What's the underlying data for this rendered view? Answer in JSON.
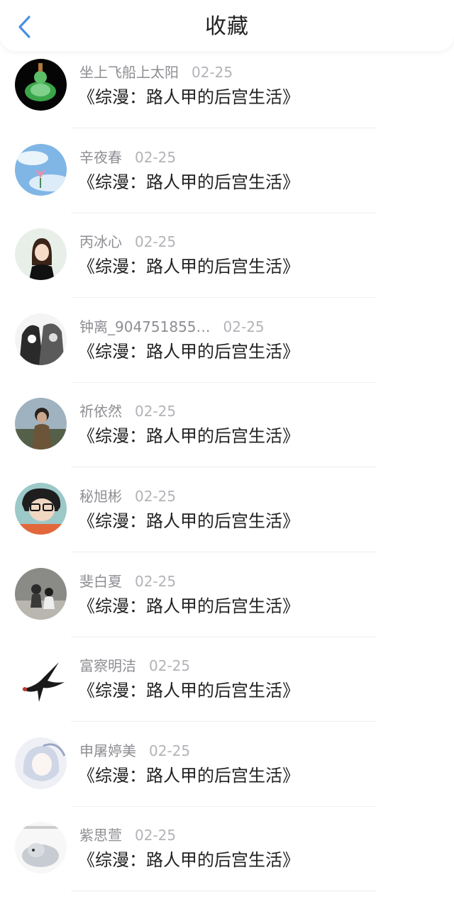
{
  "header": {
    "title": "收藏",
    "back_icon": "chevron-left-icon",
    "accent_color": "#4a90e2"
  },
  "items": [
    {
      "name": "坐上飞船上太阳",
      "date": "02-25",
      "book": "《综漫：路人甲的后宫生活》",
      "avatar": "jade-buddha"
    },
    {
      "name": "辛夜春",
      "date": "02-25",
      "book": "《综漫：路人甲的后宫生活》",
      "avatar": "lotus-sky"
    },
    {
      "name": "丙冰心",
      "date": "02-25",
      "book": "《综漫：路人甲的后宫生活》",
      "avatar": "cartoon-girl"
    },
    {
      "name": "钟离_904751855…",
      "date": "02-25",
      "book": "《综漫：路人甲的后宫生活》",
      "avatar": "sketch-couple"
    },
    {
      "name": "祈依然",
      "date": "02-25",
      "book": "《综漫：路人甲的后宫生活》",
      "avatar": "boy-outdoor"
    },
    {
      "name": "秘旭彬",
      "date": "02-25",
      "book": "《综漫：路人甲的后宫生活》",
      "avatar": "boy-glasses"
    },
    {
      "name": "斐白夏",
      "date": "02-25",
      "book": "《综漫：路人甲的后宫生活》",
      "avatar": "couple-sitting"
    },
    {
      "name": "富察明洁",
      "date": "02-25",
      "book": "《综漫：路人甲的后宫生活》",
      "avatar": "swallow-bird"
    },
    {
      "name": "申屠婷美",
      "date": "02-25",
      "book": "《综漫：路人甲的后宫生活》",
      "avatar": "anime-girl"
    },
    {
      "name": "紫思萱",
      "date": "02-25",
      "book": "《综漫：路人甲的后宫生活》",
      "avatar": "cartoon-elephant"
    }
  ]
}
